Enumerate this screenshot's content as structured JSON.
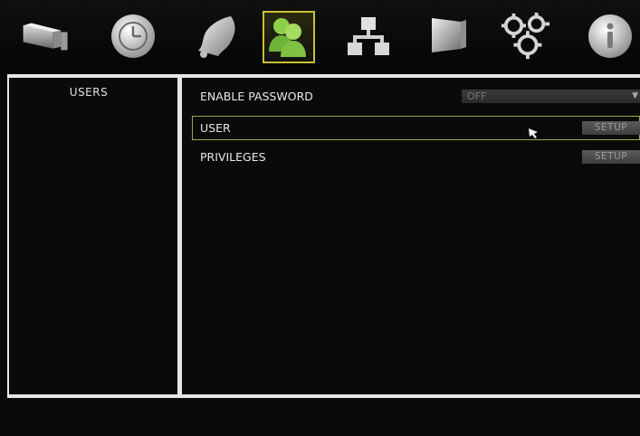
{
  "toolbar": {
    "items": [
      {
        "name": "camera"
      },
      {
        "name": "clock"
      },
      {
        "name": "alarm-bell"
      },
      {
        "name": "users",
        "active": true
      },
      {
        "name": "network"
      },
      {
        "name": "display"
      },
      {
        "name": "system-gears"
      },
      {
        "name": "info"
      }
    ]
  },
  "sidebar": {
    "items": [
      {
        "label": "USERS"
      }
    ]
  },
  "main": {
    "enable_password": {
      "label": "ENABLE PASSWORD",
      "value": "OFF"
    },
    "user": {
      "label": "USER",
      "button": "SETUP"
    },
    "privileges": {
      "label": "PRIVILEGES",
      "button": "SETUP"
    }
  },
  "colors": {
    "active_accent": "#c8c032",
    "highlight_border": "#a8a448",
    "icon_green": "#7fc241"
  }
}
